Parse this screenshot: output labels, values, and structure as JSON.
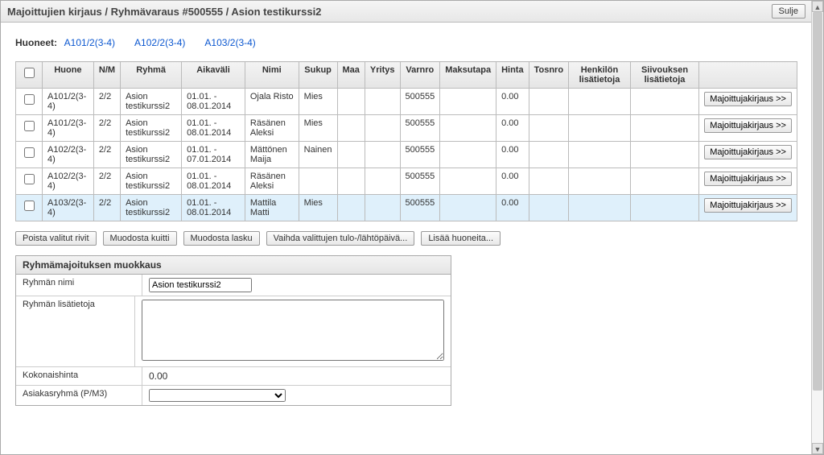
{
  "header": {
    "title": "Majoittujien kirjaus / Ryhmävaraus #500555 / Asion testikurssi2",
    "close": "Sulje"
  },
  "rooms": {
    "label": "Huoneet:",
    "items": [
      "A101/2(3-4)",
      "A102/2(3-4)",
      "A103/2(3-4)"
    ]
  },
  "table": {
    "columns": [
      "",
      "Huone",
      "N/M",
      "Ryhmä",
      "Aikaväli",
      "Nimi",
      "Sukup",
      "Maa",
      "Yritys",
      "Varnro",
      "Maksutapa",
      "Hinta",
      "Tosnro",
      "Henkilön lisätietoja",
      "Siivouksen lisätietoja",
      ""
    ],
    "rowbtn": "Majoittujakirjaus >>",
    "rows": [
      {
        "huone": "A101/2(3-4)",
        "nm": "2/2",
        "ryhma": "Asion testikurssi2",
        "aika": "01.01. - 08.01.2014",
        "nimi": "Ojala Risto",
        "sukup": "Mies",
        "maa": "",
        "yritys": "",
        "varnro": "500555",
        "maksutapa": "",
        "hinta": "0.00",
        "tosnro": "",
        "hli": "",
        "sli": "",
        "hi": false
      },
      {
        "huone": "A101/2(3-4)",
        "nm": "2/2",
        "ryhma": "Asion testikurssi2",
        "aika": "01.01. - 08.01.2014",
        "nimi": "Räsänen Aleksi",
        "sukup": "Mies",
        "maa": "",
        "yritys": "",
        "varnro": "500555",
        "maksutapa": "",
        "hinta": "0.00",
        "tosnro": "",
        "hli": "",
        "sli": "",
        "hi": false
      },
      {
        "huone": "A102/2(3-4)",
        "nm": "2/2",
        "ryhma": "Asion testikurssi2",
        "aika": "01.01. - 07.01.2014",
        "nimi": "Mättönen Maija",
        "sukup": "Nainen",
        "maa": "",
        "yritys": "",
        "varnro": "500555",
        "maksutapa": "",
        "hinta": "0.00",
        "tosnro": "",
        "hli": "",
        "sli": "",
        "hi": false
      },
      {
        "huone": "A102/2(3-4)",
        "nm": "2/2",
        "ryhma": "Asion testikurssi2",
        "aika": "01.01. - 08.01.2014",
        "nimi": "Räsänen Aleksi",
        "sukup": "",
        "maa": "",
        "yritys": "",
        "varnro": "500555",
        "maksutapa": "",
        "hinta": "0.00",
        "tosnro": "",
        "hli": "",
        "sli": "",
        "hi": false
      },
      {
        "huone": "A103/2(3-4)",
        "nm": "2/2",
        "ryhma": "Asion testikurssi2",
        "aika": "01.01. - 08.01.2014",
        "nimi": "Mattila Matti",
        "sukup": "Mies",
        "maa": "",
        "yritys": "",
        "varnro": "500555",
        "maksutapa": "",
        "hinta": "0.00",
        "tosnro": "",
        "hli": "",
        "sli": "",
        "hi": true
      }
    ]
  },
  "actions": {
    "delete": "Poista valitut rivit",
    "receipt": "Muodosta kuitti",
    "invoice": "Muodosta lasku",
    "swap": "Vaihda valittujen tulo-/lähtöpäivä...",
    "addrooms": "Lisää huoneita..."
  },
  "panel": {
    "title": "Ryhmämajoituksen muokkaus",
    "name_label": "Ryhmän nimi",
    "name_value": "Asion testikurssi2",
    "info_label": "Ryhmän lisätietoja",
    "info_value": "",
    "total_label": "Kokonaishinta",
    "total_value": "0.00",
    "custgroup_label": "Asiakasryhmä (P/M3)"
  }
}
